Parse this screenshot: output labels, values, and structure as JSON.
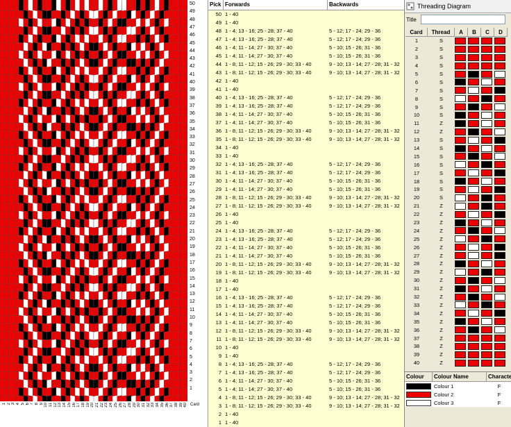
{
  "pick_table": {
    "headers": {
      "pick": "Pick",
      "forwards": "Forwards",
      "backwards": "Backwards"
    },
    "rows": [
      {
        "pick": "50",
        "forwards": "1 - 40",
        "backwards": ""
      },
      {
        "pick": "49",
        "forwards": "1 - 40",
        "backwards": ""
      },
      {
        "pick": "48",
        "forwards": "1 - 4; 13 - 16; 25 - 28; 37 - 40",
        "backwards": "5 - 12; 17 - 24; 29 - 36"
      },
      {
        "pick": "47",
        "forwards": "1 - 4; 13 - 16; 25 - 28; 37 - 40",
        "backwards": "5 - 12; 17 - 24; 29 - 36"
      },
      {
        "pick": "46",
        "forwards": "1 - 4; 11 - 14; 27 - 30; 37 - 40",
        "backwards": "5 - 10; 15 - 26; 31 - 36"
      },
      {
        "pick": "45",
        "forwards": "1 - 4; 11 - 14; 27 - 30; 37 - 40",
        "backwards": "5 - 10; 15 - 26; 31 - 36"
      },
      {
        "pick": "44",
        "forwards": "1 - 8; 11 - 12; 15 - 26; 29 - 30; 33 - 40",
        "backwards": "9 - 10; 13 - 14; 27 - 28; 31 - 32"
      },
      {
        "pick": "43",
        "forwards": "1 - 8; 11 - 12; 15 - 26; 29 - 30; 33 - 40",
        "backwards": "9 - 10; 13 - 14; 27 - 28; 31 - 32"
      },
      {
        "pick": "42",
        "forwards": "1 - 40",
        "backwards": ""
      },
      {
        "pick": "41",
        "forwards": "1 - 40",
        "backwards": ""
      },
      {
        "pick": "40",
        "forwards": "1 - 4; 13 - 16; 25 - 28; 37 - 40",
        "backwards": "5 - 12; 17 - 24; 29 - 36"
      },
      {
        "pick": "39",
        "forwards": "1 - 4; 13 - 16; 25 - 28; 37 - 40",
        "backwards": "5 - 12; 17 - 24; 29 - 36"
      },
      {
        "pick": "38",
        "forwards": "1 - 4; 11 - 14; 27 - 30; 37 - 40",
        "backwards": "5 - 10; 15 - 26; 31 - 36"
      },
      {
        "pick": "37",
        "forwards": "1 - 4; 11 - 14; 27 - 30; 37 - 40",
        "backwards": "5 - 10; 15 - 26; 31 - 36"
      },
      {
        "pick": "36",
        "forwards": "1 - 8; 11 - 12; 15 - 26; 29 - 30; 33 - 40",
        "backwards": "9 - 10; 13 - 14; 27 - 28; 31 - 32"
      },
      {
        "pick": "35",
        "forwards": "1 - 8; 11 - 12; 15 - 26; 29 - 30; 33 - 40",
        "backwards": "9 - 10; 13 - 14; 27 - 28; 31 - 32"
      },
      {
        "pick": "34",
        "forwards": "1 - 40",
        "backwards": ""
      },
      {
        "pick": "33",
        "forwards": "1 - 40",
        "backwards": ""
      },
      {
        "pick": "32",
        "forwards": "1 - 4; 13 - 16; 25 - 28; 37 - 40",
        "backwards": "5 - 12; 17 - 24; 29 - 36"
      },
      {
        "pick": "31",
        "forwards": "1 - 4; 13 - 16; 25 - 28; 37 - 40",
        "backwards": "5 - 12; 17 - 24; 29 - 36"
      },
      {
        "pick": "30",
        "forwards": "1 - 4; 11 - 14; 27 - 30; 37 - 40",
        "backwards": "5 - 10; 15 - 26; 31 - 36"
      },
      {
        "pick": "29",
        "forwards": "1 - 4; 11 - 14; 27 - 30; 37 - 40",
        "backwards": "5 - 10; 15 - 26; 31 - 36"
      },
      {
        "pick": "28",
        "forwards": "1 - 8; 11 - 12; 15 - 26; 29 - 30; 33 - 40",
        "backwards": "9 - 10; 13 - 14; 27 - 28; 31 - 32"
      },
      {
        "pick": "27",
        "forwards": "1 - 8; 11 - 12; 15 - 26; 29 - 30; 33 - 40",
        "backwards": "9 - 10; 13 - 14; 27 - 28; 31 - 32"
      },
      {
        "pick": "26",
        "forwards": "1 - 40",
        "backwards": ""
      },
      {
        "pick": "25",
        "forwards": "1 - 40",
        "backwards": ""
      },
      {
        "pick": "24",
        "forwards": "1 - 4; 13 - 16; 25 - 28; 37 - 40",
        "backwards": "5 - 12; 17 - 24; 29 - 36"
      },
      {
        "pick": "23",
        "forwards": "1 - 4; 13 - 16; 25 - 28; 37 - 40",
        "backwards": "5 - 12; 17 - 24; 29 - 36"
      },
      {
        "pick": "22",
        "forwards": "1 - 4; 11 - 14; 27 - 30; 37 - 40",
        "backwards": "5 - 10; 15 - 26; 31 - 36"
      },
      {
        "pick": "21",
        "forwards": "1 - 4; 11 - 14; 27 - 30; 37 - 40",
        "backwards": "5 - 10; 15 - 26; 31 - 36"
      },
      {
        "pick": "20",
        "forwards": "1 - 8; 11 - 12; 15 - 26; 29 - 30; 33 - 40",
        "backwards": "9 - 10; 13 - 14; 27 - 28; 31 - 32"
      },
      {
        "pick": "19",
        "forwards": "1 - 8; 11 - 12; 15 - 26; 29 - 30; 33 - 40",
        "backwards": "9 - 10; 13 - 14; 27 - 28; 31 - 32"
      },
      {
        "pick": "18",
        "forwards": "1 - 40",
        "backwards": ""
      },
      {
        "pick": "17",
        "forwards": "1 - 40",
        "backwards": ""
      },
      {
        "pick": "16",
        "forwards": "1 - 4; 13 - 16; 25 - 28; 37 - 40",
        "backwards": "5 - 12; 17 - 24; 29 - 36"
      },
      {
        "pick": "15",
        "forwards": "1 - 4; 13 - 16; 25 - 28; 37 - 40",
        "backwards": "5 - 12; 17 - 24; 29 - 36"
      },
      {
        "pick": "14",
        "forwards": "1 - 4; 11 - 14; 27 - 30; 37 - 40",
        "backwards": "5 - 10; 15 - 26; 31 - 36"
      },
      {
        "pick": "13",
        "forwards": "1 - 4; 11 - 14; 27 - 30; 37 - 40",
        "backwards": "5 - 10; 15 - 26; 31 - 36"
      },
      {
        "pick": "12",
        "forwards": "1 - 8; 11 - 12; 15 - 26; 29 - 30; 33 - 40",
        "backwards": "9 - 10; 13 - 14; 27 - 28; 31 - 32"
      },
      {
        "pick": "11",
        "forwards": "1 - 8; 11 - 12; 15 - 26; 29 - 30; 33 - 40",
        "backwards": "9 - 10; 13 - 14; 27 - 28; 31 - 32"
      },
      {
        "pick": "10",
        "forwards": "1 - 40",
        "backwards": ""
      },
      {
        "pick": "9",
        "forwards": "1 - 40",
        "backwards": ""
      },
      {
        "pick": "8",
        "forwards": "1 - 4; 13 - 16; 25 - 28; 37 - 40",
        "backwards": "5 - 12; 17 - 24; 29 - 36"
      },
      {
        "pick": "7",
        "forwards": "1 - 4; 13 - 16; 25 - 28; 37 - 40",
        "backwards": "5 - 12; 17 - 24; 29 - 36"
      },
      {
        "pick": "6",
        "forwards": "1 - 4; 11 - 14; 27 - 30; 37 - 40",
        "backwards": "5 - 10; 15 - 26; 31 - 36"
      },
      {
        "pick": "5",
        "forwards": "1 - 4; 11 - 14; 27 - 30; 37 - 40",
        "backwards": "5 - 10; 15 - 26; 31 - 36"
      },
      {
        "pick": "4",
        "forwards": "1 - 8; 11 - 12; 15 - 26; 29 - 30; 33 - 40",
        "backwards": "9 - 10; 13 - 14; 27 - 28; 31 - 32"
      },
      {
        "pick": "3",
        "forwards": "1 - 8; 11 - 12; 15 - 26; 29 - 30; 33 - 40",
        "backwards": "9 - 10; 13 - 14; 27 - 28; 31 - 32"
      },
      {
        "pick": "2",
        "forwards": "1 - 40",
        "backwards": ""
      },
      {
        "pick": "1",
        "forwards": "1 - 40",
        "backwards": ""
      }
    ]
  },
  "threading_panel": {
    "window_title": "Threading Diagram",
    "title_label": "Title",
    "title_value": "",
    "headers": {
      "card": "Card",
      "thread": "Thread",
      "holes": [
        "A",
        "B",
        "C",
        "D"
      ]
    },
    "colours": {
      "1": "#000000",
      "2": "#ee0000",
      "3": "#ffffff"
    },
    "cards": [
      {
        "card": "1",
        "thread": "S",
        "holes": [
          2,
          2,
          2,
          2
        ]
      },
      {
        "card": "2",
        "thread": "S",
        "holes": [
          2,
          2,
          2,
          2
        ]
      },
      {
        "card": "3",
        "thread": "S",
        "holes": [
          2,
          2,
          2,
          2
        ]
      },
      {
        "card": "4",
        "thread": "S",
        "holes": [
          2,
          2,
          2,
          2
        ]
      },
      {
        "card": "5",
        "thread": "S",
        "holes": [
          2,
          1,
          2,
          3
        ]
      },
      {
        "card": "6",
        "thread": "S",
        "holes": [
          1,
          2,
          3,
          2
        ]
      },
      {
        "card": "7",
        "thread": "S",
        "holes": [
          2,
          3,
          2,
          1
        ]
      },
      {
        "card": "8",
        "thread": "S",
        "holes": [
          3,
          2,
          1,
          2
        ]
      },
      {
        "card": "9",
        "thread": "S",
        "holes": [
          2,
          1,
          2,
          3
        ]
      },
      {
        "card": "10",
        "thread": "S",
        "holes": [
          1,
          2,
          3,
          2
        ]
      },
      {
        "card": "11",
        "thread": "Z",
        "holes": [
          1,
          2,
          3,
          2
        ]
      },
      {
        "card": "12",
        "thread": "Z",
        "holes": [
          2,
          1,
          2,
          3
        ]
      },
      {
        "card": "13",
        "thread": "S",
        "holes": [
          2,
          3,
          2,
          1
        ]
      },
      {
        "card": "14",
        "thread": "S",
        "holes": [
          1,
          2,
          3,
          2
        ]
      },
      {
        "card": "15",
        "thread": "S",
        "holes": [
          2,
          1,
          2,
          3
        ]
      },
      {
        "card": "16",
        "thread": "S",
        "holes": [
          3,
          2,
          1,
          2
        ]
      },
      {
        "card": "17",
        "thread": "S",
        "holes": [
          2,
          3,
          2,
          1
        ]
      },
      {
        "card": "18",
        "thread": "S",
        "holes": [
          1,
          2,
          3,
          2
        ]
      },
      {
        "card": "19",
        "thread": "S",
        "holes": [
          2,
          3,
          2,
          1
        ]
      },
      {
        "card": "20",
        "thread": "S",
        "holes": [
          3,
          2,
          1,
          2
        ]
      },
      {
        "card": "21",
        "thread": "Z",
        "holes": [
          3,
          2,
          1,
          2
        ]
      },
      {
        "card": "22",
        "thread": "Z",
        "holes": [
          2,
          3,
          2,
          1
        ]
      },
      {
        "card": "23",
        "thread": "Z",
        "holes": [
          1,
          2,
          3,
          2
        ]
      },
      {
        "card": "24",
        "thread": "Z",
        "holes": [
          2,
          1,
          2,
          3
        ]
      },
      {
        "card": "25",
        "thread": "Z",
        "holes": [
          3,
          2,
          1,
          2
        ]
      },
      {
        "card": "26",
        "thread": "Z",
        "holes": [
          2,
          3,
          2,
          1
        ]
      },
      {
        "card": "27",
        "thread": "Z",
        "holes": [
          2,
          3,
          2,
          1
        ]
      },
      {
        "card": "28",
        "thread": "Z",
        "holes": [
          1,
          2,
          3,
          2
        ]
      },
      {
        "card": "29",
        "thread": "Z",
        "holes": [
          3,
          2,
          1,
          2
        ]
      },
      {
        "card": "30",
        "thread": "Z",
        "holes": [
          2,
          1,
          2,
          3
        ]
      },
      {
        "card": "31",
        "thread": "Z",
        "holes": [
          1,
          2,
          3,
          2
        ]
      },
      {
        "card": "32",
        "thread": "Z",
        "holes": [
          2,
          1,
          2,
          3
        ]
      },
      {
        "card": "33",
        "thread": "Z",
        "holes": [
          3,
          2,
          1,
          2
        ]
      },
      {
        "card": "34",
        "thread": "Z",
        "holes": [
          2,
          3,
          2,
          1
        ]
      },
      {
        "card": "35",
        "thread": "Z",
        "holes": [
          1,
          2,
          3,
          2
        ]
      },
      {
        "card": "36",
        "thread": "Z",
        "holes": [
          2,
          1,
          2,
          3
        ]
      },
      {
        "card": "37",
        "thread": "Z",
        "holes": [
          2,
          2,
          2,
          2
        ]
      },
      {
        "card": "38",
        "thread": "Z",
        "holes": [
          2,
          2,
          2,
          2
        ]
      },
      {
        "card": "39",
        "thread": "Z",
        "holes": [
          2,
          2,
          2,
          2
        ]
      },
      {
        "card": "40",
        "thread": "Z",
        "holes": [
          2,
          2,
          2,
          2
        ]
      }
    ]
  },
  "colour_table": {
    "headers": {
      "colour": "Colour",
      "name": "Colour Name",
      "character": "Character"
    },
    "rows": [
      {
        "swatch": "#000000",
        "name": "Colour 1",
        "character": "F"
      },
      {
        "swatch": "#ee0000",
        "name": "Colour 2",
        "character": "F"
      },
      {
        "swatch": "#ffffff",
        "name": "Colour 3",
        "character": "F"
      }
    ]
  },
  "pattern_view": {
    "pick_labels": [
      "50",
      "49",
      "48",
      "47",
      "46",
      "45",
      "44",
      "43",
      "42",
      "41",
      "40",
      "39",
      "38",
      "37",
      "36",
      "35",
      "34",
      "33",
      "32",
      "31",
      "30",
      "29",
      "28",
      "27",
      "26",
      "25",
      "24",
      "23",
      "22",
      "21",
      "20",
      "19",
      "18",
      "17",
      "16",
      "15",
      "14",
      "13",
      "12",
      "11",
      "10",
      "9",
      "8",
      "7",
      "6",
      "5",
      "4",
      "3",
      "2",
      "1"
    ],
    "card_labels": [
      "1",
      "2",
      "3",
      "4",
      "5",
      "6",
      "7",
      "8",
      "9",
      "10",
      "11",
      "12",
      "13",
      "14",
      "15",
      "16",
      "17",
      "18",
      "19",
      "20",
      "21",
      "22",
      "23",
      "24",
      "25",
      "26",
      "27",
      "28",
      "29",
      "30",
      "31",
      "32",
      "33",
      "34",
      "35",
      "36",
      "37",
      "38",
      "39",
      "40"
    ],
    "card_axis_title": "Card"
  }
}
